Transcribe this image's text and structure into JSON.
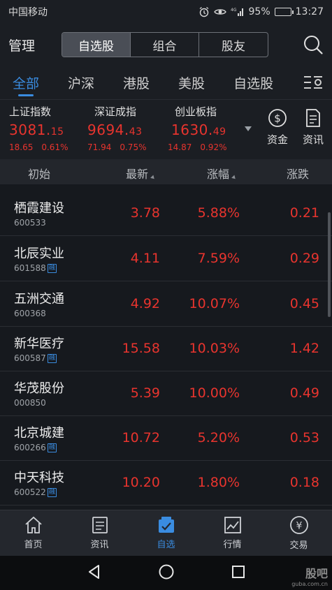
{
  "status_bar": {
    "carrier": "中国移动",
    "network": "4G",
    "battery": "95%",
    "battery_level": 0.95,
    "time": "13:27"
  },
  "header": {
    "manage_label": "管理",
    "segments": [
      "自选股",
      "组合",
      "股友"
    ],
    "active_segment": 0
  },
  "tabs": {
    "items": [
      "全部",
      "沪深",
      "港股",
      "美股",
      "自选股"
    ],
    "active": 0
  },
  "indices": [
    {
      "name": "上证指数",
      "value_int": "3081.",
      "value_dec": "15",
      "change": "18.65",
      "percent": "0.61%"
    },
    {
      "name": "深证成指",
      "value_int": "9694.",
      "value_dec": "43",
      "change": "71.94",
      "percent": "0.75%"
    },
    {
      "name": "创业板指",
      "value_int": "1630.",
      "value_dec": "49",
      "change": "14.87",
      "percent": "0.92%"
    }
  ],
  "side_buttons": {
    "capital": "资金",
    "news": "资讯"
  },
  "columns": {
    "initial": "初始",
    "latest": "最新",
    "change_pct": "涨幅",
    "change": "涨跌"
  },
  "stocks": [
    {
      "name": "栖霞建设",
      "code": "600533",
      "margin": "",
      "price": "3.78",
      "pct": "5.88%",
      "chg": "0.21"
    },
    {
      "name": "北辰实业",
      "code": "601588",
      "margin": "融",
      "price": "4.11",
      "pct": "7.59%",
      "chg": "0.29"
    },
    {
      "name": "五洲交通",
      "code": "600368",
      "margin": "",
      "price": "4.92",
      "pct": "10.07%",
      "chg": "0.45"
    },
    {
      "name": "新华医疗",
      "code": "600587",
      "margin": "融",
      "price": "15.58",
      "pct": "10.03%",
      "chg": "1.42"
    },
    {
      "name": "华茂股份",
      "code": "000850",
      "margin": "",
      "price": "5.39",
      "pct": "10.00%",
      "chg": "0.49"
    },
    {
      "name": "北京城建",
      "code": "600266",
      "margin": "融",
      "price": "10.72",
      "pct": "5.20%",
      "chg": "0.53"
    },
    {
      "name": "中天科技",
      "code": "600522",
      "margin": "融",
      "price": "10.20",
      "pct": "1.80%",
      "chg": "0.18"
    }
  ],
  "bottom_nav": [
    {
      "label": "首页",
      "icon": "home-icon"
    },
    {
      "label": "资讯",
      "icon": "news-icon"
    },
    {
      "label": "自选",
      "icon": "watchlist-icon"
    },
    {
      "label": "行情",
      "icon": "market-icon"
    },
    {
      "label": "交易",
      "icon": "trade-icon"
    }
  ],
  "active_nav": 2,
  "watermark": {
    "line1": "股吧",
    "line2": "guba.com.cn"
  },
  "colors": {
    "up": "#e8342e",
    "accent": "#3a8ce0",
    "background": "#16191e"
  }
}
